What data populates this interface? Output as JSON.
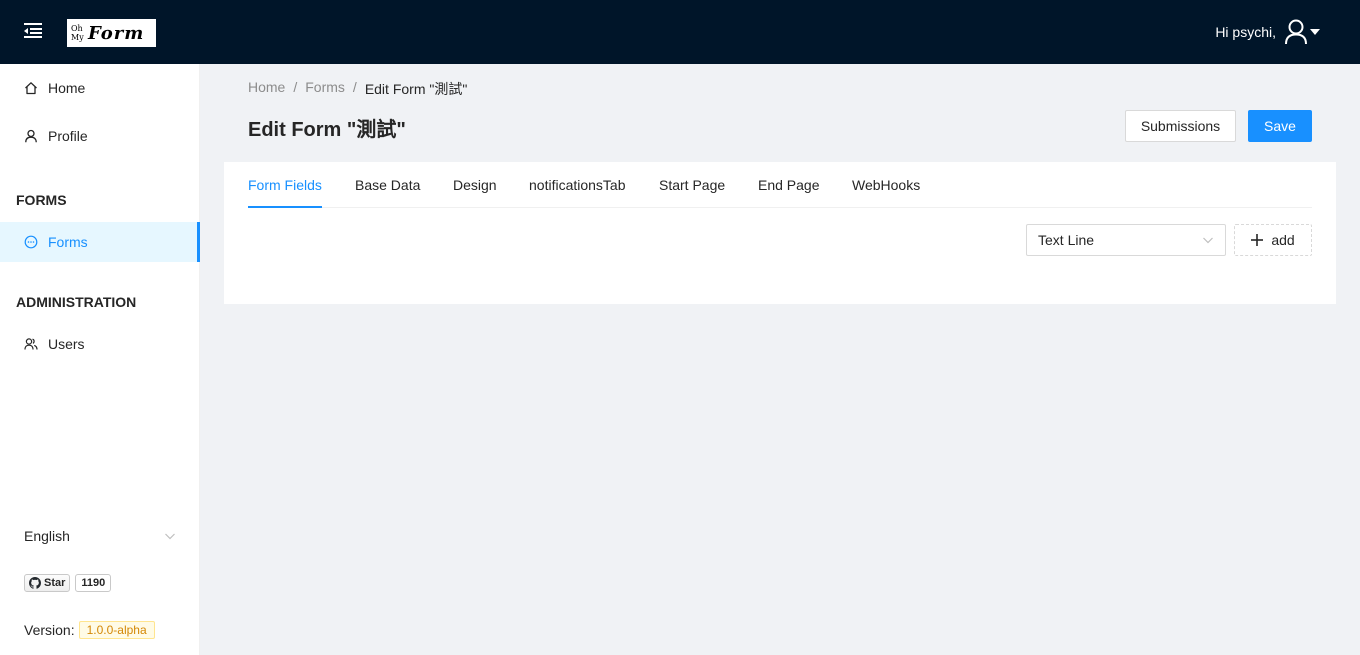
{
  "header": {
    "logo_small": "Oh My",
    "logo_big": "Form",
    "greeting": "Hi psychi,"
  },
  "sidebar": {
    "items": [
      {
        "label": "Home",
        "icon": "home-icon"
      },
      {
        "label": "Profile",
        "icon": "user-icon"
      },
      {
        "label": "Forms",
        "icon": "message-icon",
        "active": true
      },
      {
        "label": "Users",
        "icon": "team-icon"
      }
    ],
    "sections": {
      "forms": "FORMS",
      "administration": "ADMINISTRATION"
    },
    "language": "English",
    "github": {
      "star_label": "Star",
      "count": "1190"
    },
    "version_label": "Version:",
    "version": "1.0.0-alpha"
  },
  "breadcrumb": [
    "Home",
    "Forms",
    "Edit Form \"測試\""
  ],
  "page": {
    "title": "Edit Form \"測試\"",
    "submissions_label": "Submissions",
    "save_label": "Save"
  },
  "tabs": [
    {
      "label": "Form Fields",
      "active": true
    },
    {
      "label": "Base Data"
    },
    {
      "label": "Design"
    },
    {
      "label": "notificationsTab"
    },
    {
      "label": "Start Page"
    },
    {
      "label": "End Page"
    },
    {
      "label": "WebHooks"
    }
  ],
  "field_select": "Text Line",
  "add_label": "add",
  "colors": {
    "primary": "#1890ff",
    "header_bg": "#001529",
    "bg": "#f0f2f5"
  }
}
